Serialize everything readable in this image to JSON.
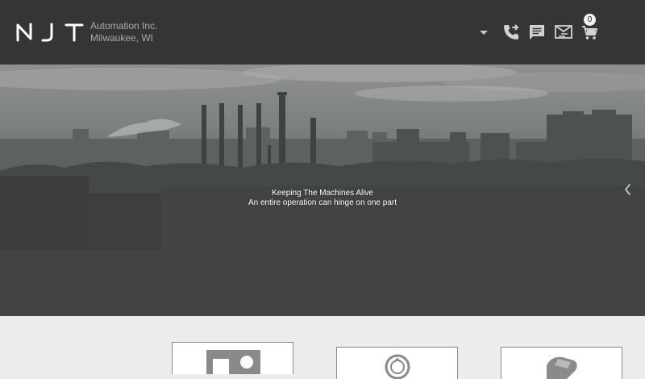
{
  "brand": {
    "logo_text": "NJT",
    "company_name": "Automation Inc.",
    "location": "Milwaukee, WI"
  },
  "header": {
    "icons": [
      "chevron-down-icon",
      "phone-forward-icon",
      "chat-icon",
      "mail-exchange-icon",
      "cart-icon"
    ],
    "cart_count": "0"
  },
  "hero": {
    "title": "Keeping The Machines Alive",
    "subtitle": "An entire operation can hinge on one part",
    "next_icon": "chevron-right-icon"
  },
  "categories": {
    "cards": [
      {
        "icon": "id-card-icon"
      },
      {
        "icon": "bearing-icon"
      },
      {
        "icon": "belt-icon"
      }
    ]
  },
  "colors": {
    "header_bg": "#353535",
    "page_bg": "#ececec",
    "caption_text": "#ffffff"
  }
}
